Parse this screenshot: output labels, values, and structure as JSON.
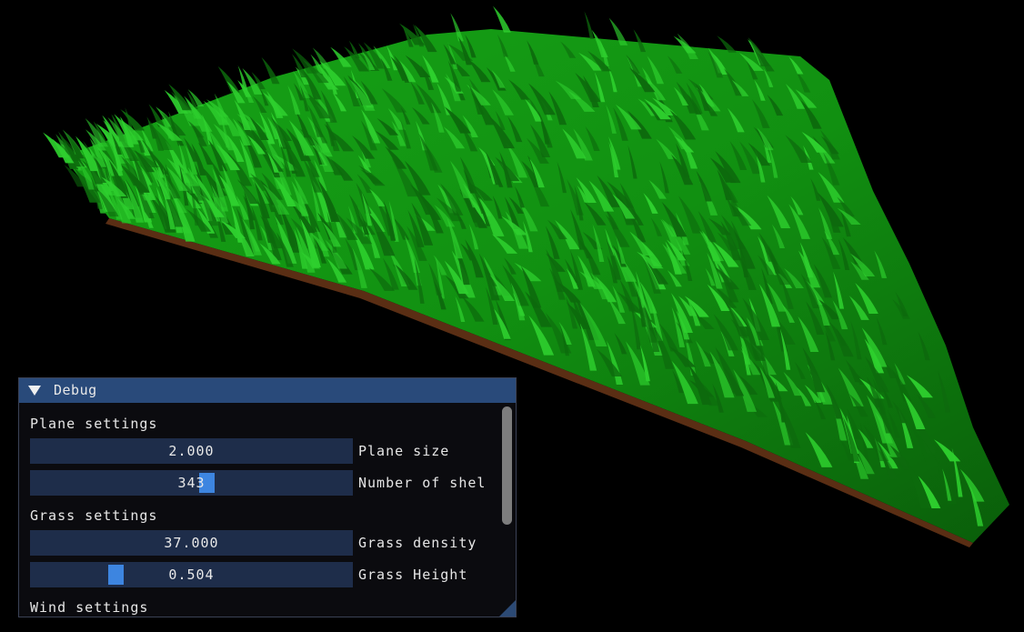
{
  "window": {
    "title": "Debug",
    "sections": [
      {
        "label": "Plane settings",
        "sliders": [
          {
            "value": "2.000",
            "label": "Plane size",
            "fraction": null
          },
          {
            "value": "343",
            "label": "Number of shel",
            "fraction": 0.55
          }
        ]
      },
      {
        "label": "Grass settings",
        "sliders": [
          {
            "value": "37.000",
            "label": "Grass density",
            "fraction": null
          },
          {
            "value": "0.504",
            "label": "Grass Height",
            "fraction": 0.25
          }
        ]
      },
      {
        "label": "Wind settings",
        "sliders": []
      }
    ]
  },
  "colors": {
    "grass_light": "#2ecf2e",
    "grass_dark": "#0d6a0d",
    "soil": "#6b3a1a",
    "title_bar": "#294a7a",
    "slider_bg": "#1e2d4a",
    "slider_grab": "#3d85e0"
  },
  "icons": {
    "collapse": "collapse-triangle-icon"
  }
}
